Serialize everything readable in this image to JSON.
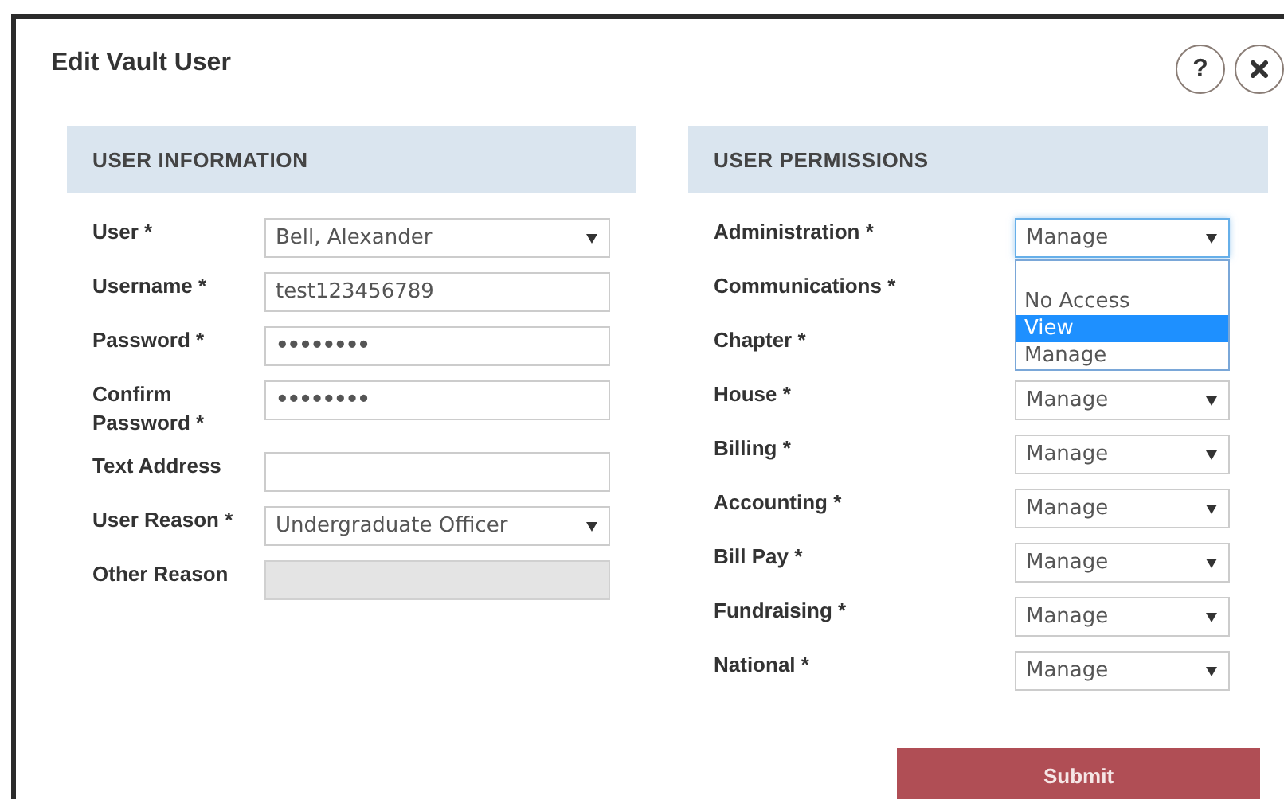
{
  "dialog": {
    "title": "Edit Vault User",
    "help_button": "?"
  },
  "user_information": {
    "heading": "USER INFORMATION",
    "fields": [
      {
        "kind": "select",
        "label": "User *",
        "value": "Bell, Alexander",
        "disabled": false
      },
      {
        "kind": "text",
        "label": "Username *",
        "value": "test123456789",
        "disabled": false
      },
      {
        "kind": "password",
        "label": "Password *",
        "value": "••••••••",
        "disabled": false
      },
      {
        "kind": "password",
        "label": "Confirm Password *",
        "value": "••••••••",
        "disabled": false
      },
      {
        "kind": "text",
        "label": "Text Address",
        "disabled": false
      },
      {
        "kind": "select",
        "label": "User Reason *",
        "value": "Undergraduate Officer",
        "disabled": false
      },
      {
        "kind": "text",
        "label": "Other Reason",
        "disabled": true
      }
    ]
  },
  "user_permissions": {
    "heading": "USER PERMISSIONS",
    "rows": [
      {
        "label": "Administration *",
        "value": "Manage",
        "open_dropdown": {
          "options": [
            {
              "label": "No Access",
              "selected": false
            },
            {
              "label": "View",
              "selected": true
            },
            {
              "label": "Manage",
              "selected": false
            }
          ]
        }
      },
      {
        "label": "Communications *"
      },
      {
        "label": "Chapter *"
      },
      {
        "label": "House *",
        "value": "Manage"
      },
      {
        "label": "Billing *",
        "value": "Manage"
      },
      {
        "label": "Accounting *",
        "value": "Manage"
      },
      {
        "label": "Bill Pay *",
        "value": "Manage"
      },
      {
        "label": "Fundraising *",
        "value": "Manage"
      },
      {
        "label": "National *",
        "value": "Manage"
      }
    ]
  },
  "submit_button": "Submit"
}
